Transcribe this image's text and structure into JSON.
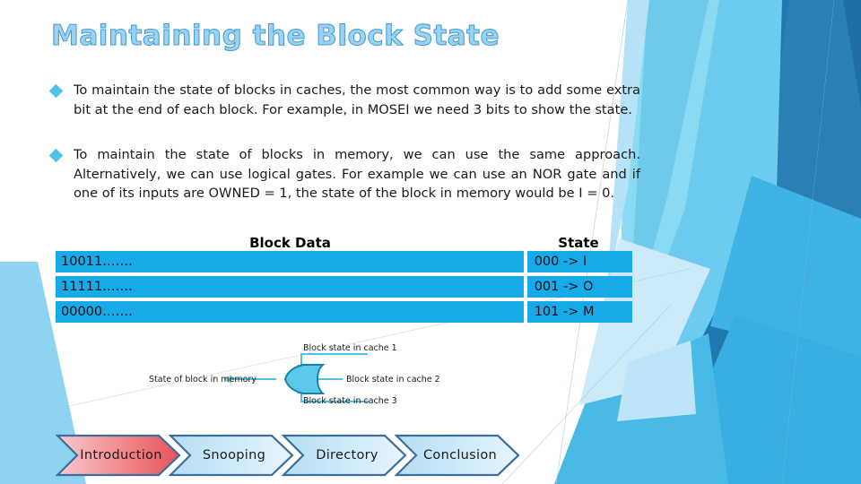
{
  "slide": {
    "title": "Maintaining the Block State",
    "theme_colors": {
      "title_fill": "#9CD2F0",
      "title_outline": "#3E9BD4",
      "bullet_diamond": "#4FC3E8",
      "table_cell_bg": "#17A9E8",
      "accent_dark_blue": "#2078AE",
      "accent_mid_blue": "#46B4E4",
      "accent_light_blue": "#8ED4F0",
      "accent_pale_blue": "#CDEAF8",
      "nav_active_start": "#F9C9CC",
      "nav_active_end": "#E9525A",
      "nav_inactive_start": "#BEE2F6",
      "nav_inactive_end": "#E8F5FC",
      "nav_border": "#3B6E9B",
      "gate_fill": "#5BC8EC",
      "gate_stroke": "#1B7FA8"
    }
  },
  "bullets": [
    {
      "marker": "diamond-bullet-icon",
      "text": "To maintain the state of blocks in caches, the most common way is to add some extra bit at the end of each block. For example, in MOSEI we need 3 bits to show the state."
    },
    {
      "marker": "diamond-bullet-icon",
      "text": "To maintain the state of blocks in memory, we can use the same approach. Alternatively, we can use logical gates. For example we can use an NOR gate and if one of its inputs are OWNED = 1, the state of the block in memory would be I = 0."
    }
  ],
  "table": {
    "headers": [
      "Block Data",
      "State"
    ],
    "rows": [
      {
        "block_data": "10011…….",
        "state": "000 -> I"
      },
      {
        "block_data": "11111…….",
        "state": "001 -> O"
      },
      {
        "block_data": "00000…….",
        "state": "101 -> M"
      }
    ]
  },
  "diagram": {
    "gate_type": "nor-gate",
    "labels": {
      "cache1": "Block state in cache 1",
      "cache2": "Block state in cache 2",
      "cache3": "Block state in cache 3",
      "memory": "State of block in memory"
    }
  },
  "nav": {
    "items": [
      {
        "label": "Introduction",
        "active": true
      },
      {
        "label": "Snooping",
        "active": false
      },
      {
        "label": "Directory",
        "active": false
      },
      {
        "label": "Conclusion",
        "active": false
      }
    ]
  }
}
